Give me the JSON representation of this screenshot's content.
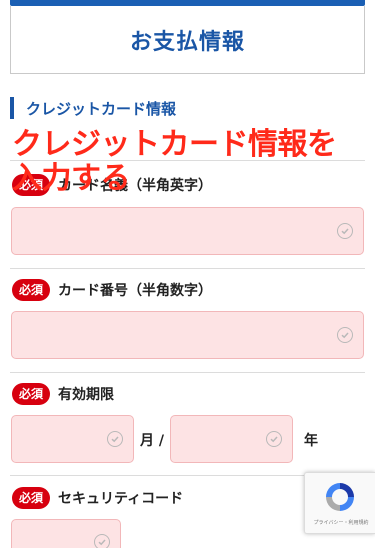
{
  "page": {
    "title": "お支払情報",
    "section_title": "クレジットカード情報",
    "overlay_caption_line1": "クレジットカード情報を",
    "overlay_caption_line2": "入力する"
  },
  "form": {
    "required_label": "必須",
    "card_name_label": "カード名義（半角英字）",
    "card_number_label": "カード番号（半角数字）",
    "expiry_label": "有効期限",
    "month_unit": "月 /",
    "year_unit": "年",
    "security_code_label": "セキュリティコード"
  },
  "recaptcha": {
    "footer_text": "プライバシー・利用規約"
  },
  "colors": {
    "accent_blue": "#1a56a6",
    "required_red": "#d7000f",
    "field_pink": "#fde3e4",
    "overlay_red": "#ff2a1a"
  }
}
